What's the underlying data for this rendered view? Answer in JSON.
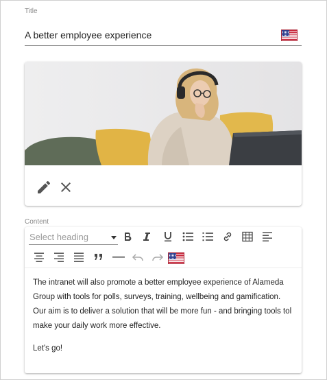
{
  "title_field": {
    "label": "Title",
    "value": "A better employee experience",
    "language_flag_icon": "us-flag-icon"
  },
  "image_card": {
    "image_description_icon": "photo",
    "actions": [
      {
        "name": "edit",
        "icon": "pencil-icon"
      },
      {
        "name": "remove",
        "icon": "close-icon"
      }
    ]
  },
  "content_field": {
    "label": "Content",
    "toolbar": {
      "heading_placeholder": "Select heading",
      "buttons": [
        "bold",
        "italic",
        "underline",
        "bulleted-list",
        "numbered-list",
        "link",
        "table",
        "align-left",
        "align-center",
        "align-right",
        "align-justify",
        "blockquote",
        "horizontal-line",
        "undo",
        "redo",
        "language-flag"
      ]
    },
    "paragraphs": [
      "The intranet will also promote a better employee experience of Alameda Group with tools for polls, surveys, training, wellbeing and gamification. Our aim is to deliver a solution that will be more fun - and bringing tools tol make your daily work more effective.",
      "Let's go!"
    ]
  },
  "colors": {
    "flag_red": "#c8283c",
    "flag_blue": "#2e3f8f",
    "icon_gray": "#555555",
    "label_gray": "#8a8a8a"
  }
}
